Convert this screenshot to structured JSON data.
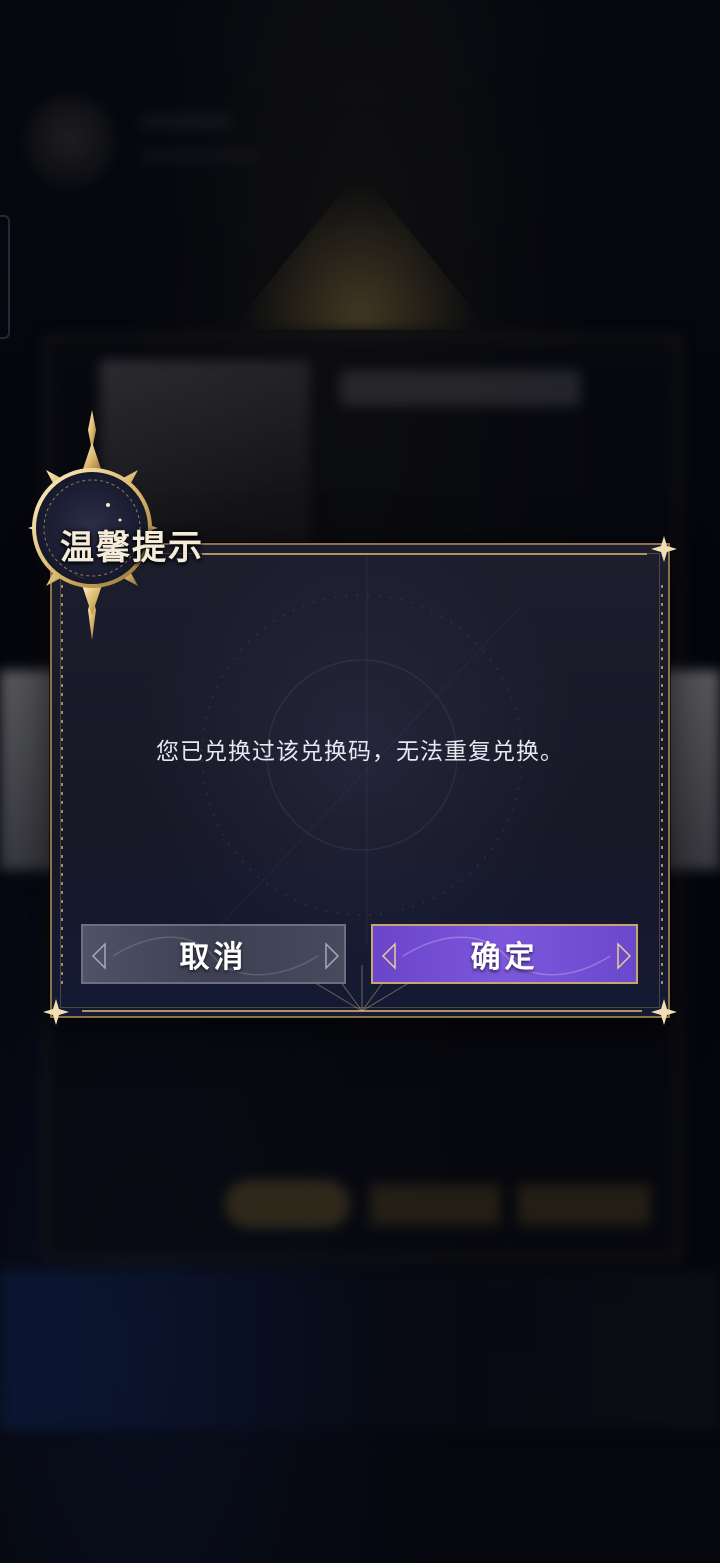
{
  "dialog": {
    "title": "温馨提示",
    "message": "您已兑换过该兑换码，无法重复兑换。",
    "cancel_label": "取消",
    "confirm_label": "确定"
  },
  "colors": {
    "frame_gold": "#8c7346",
    "confirm_purple": "#7c57dc",
    "cancel_gray": "#45475b",
    "dialog_bg": "#1a1c2b"
  },
  "icons": {
    "emblem": "moon-sun-emblem-icon",
    "corner": "diamond-star-icon"
  }
}
